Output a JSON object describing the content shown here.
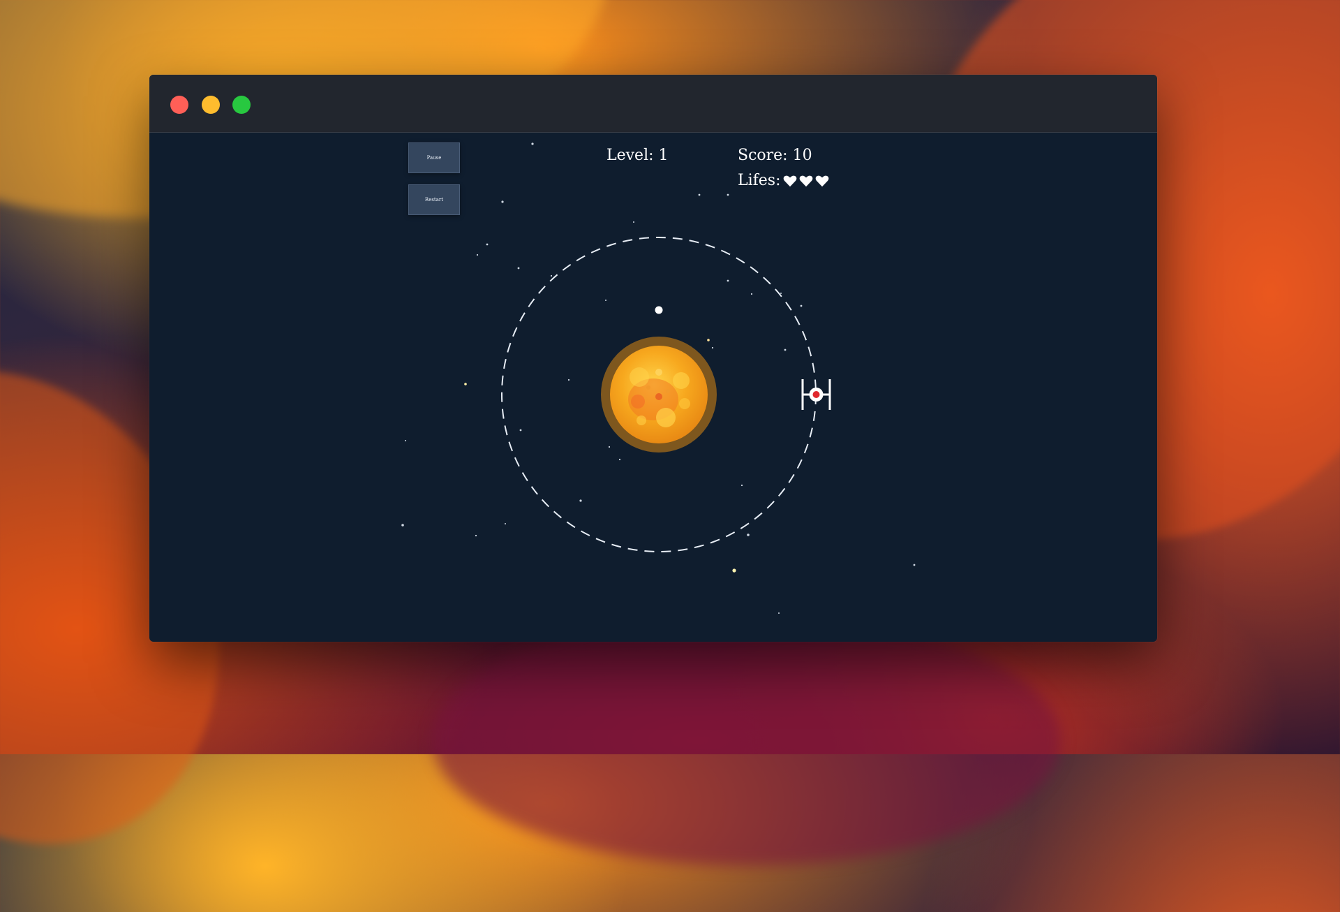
{
  "window": {
    "controls": [
      "close",
      "minimize",
      "zoom"
    ]
  },
  "controls": {
    "pause_label": "Pause",
    "restart_label": "Restart"
  },
  "hud": {
    "level_label": "Level:",
    "level_value": "1",
    "score_label": "Score:",
    "score_value": "10",
    "lifes_label": "Lifes:",
    "lifes_count": 3,
    "heart_icon": "heart-icon"
  },
  "game": {
    "sun_icon": "sun-icon",
    "ship_icon": "tie-fighter-icon",
    "projectile_icon": "ball-icon",
    "orbit_style": "dashed"
  },
  "colors": {
    "window_bg": "#0f1d2e",
    "titlebar_bg": "#22262e",
    "button_bg": "#34465e",
    "sun_core": "#f7b21c",
    "ship_accent": "#e0282d"
  }
}
